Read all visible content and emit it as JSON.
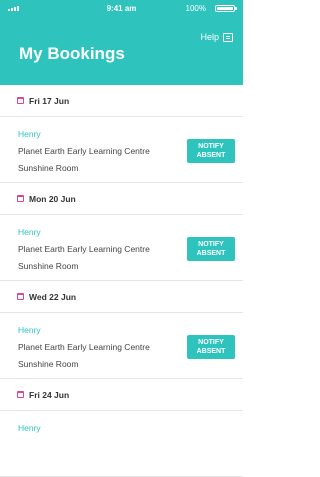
{
  "status_bar": {
    "time": "9:41 am",
    "battery": "100%"
  },
  "header": {
    "title": "My Bookings",
    "help_label": "Help"
  },
  "bookings": [
    {
      "date": "Fri 17 Jun",
      "child": "Henry",
      "centre": "Planet Earth Early Learning Centre",
      "room": "Sunshine Room",
      "action_label": "NOTIFY ABSENT"
    },
    {
      "date": "Mon 20 Jun",
      "child": "Henry",
      "centre": "Planet Earth Early Learning Centre",
      "room": "Sunshine Room",
      "action_label": "NOTIFY ABSENT"
    },
    {
      "date": "Wed 22 Jun",
      "child": "Henry",
      "centre": "Planet Earth Early Learning Centre",
      "room": "Sunshine Room",
      "action_label": "NOTIFY ABSENT"
    },
    {
      "date": "Fri 24 Jun",
      "child": "Henry",
      "centre": "",
      "room": "",
      "action_label": ""
    }
  ],
  "colors": {
    "accent": "#2ec4bd",
    "calendar_icon": "#e0458a"
  }
}
